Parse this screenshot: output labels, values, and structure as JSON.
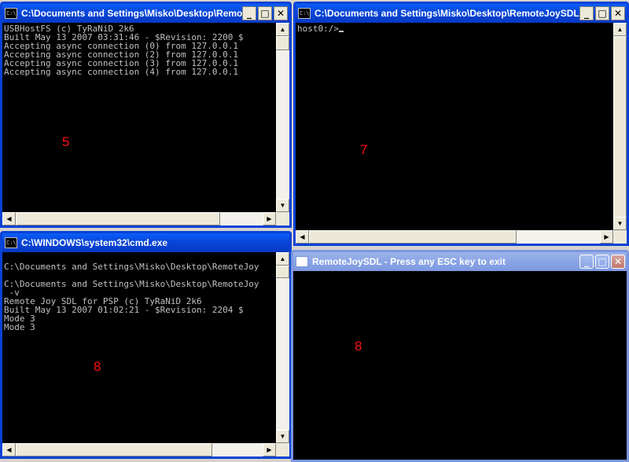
{
  "windows": {
    "usbhostfs": {
      "title": "C:\\Documents and Settings\\Misko\\Desktop\\RemoteJ...",
      "lines": "USBHostFS (c) TyRaNiD 2k6\nBuilt May 13 2007 03:31:46 - $Revision: 2200 $\nAccepting async connection (0) from 127.0.0.1\nAccepting async connection (2) from 127.0.0.1\nAccepting async connection (3) from 127.0.0.1\nAccepting async connection (4) from 127.0.0.1",
      "marker": "5"
    },
    "pcterm": {
      "title": "C:\\Documents and Settings\\Misko\\Desktop\\RemoteJoySDL\\PC\\...",
      "prompt": "host0:/>",
      "marker": "7"
    },
    "cmd": {
      "title": "C:\\WINDOWS\\system32\\cmd.exe",
      "lines": "\nC:\\Documents and Settings\\Misko\\Desktop\\RemoteJoy\n\nC:\\Documents and Settings\\Misko\\Desktop\\RemoteJoy\n -v\nRemote Joy SDL for PSP (c) TyRaNiD 2k6\nBuilt May 13 2007 01:02:21 - $Revision: 2204 $\nMode 3\nMode 3",
      "marker": "8"
    },
    "sdl": {
      "title": "RemoteJoySDL - Press any ESC key to exit",
      "marker": "8"
    }
  },
  "glyphs": {
    "minimize": "_",
    "maximize": "□",
    "close": "✕",
    "up": "▲",
    "down": "▼",
    "left": "◀",
    "right": "▶",
    "console_icon": "C:\\"
  },
  "colors": {
    "titlebar_active": "#0846d8",
    "titlebar_inactive": "#8aa5e6",
    "console_bg": "#000000",
    "console_text": "#c0c0c0",
    "marker": "#ff1010"
  }
}
